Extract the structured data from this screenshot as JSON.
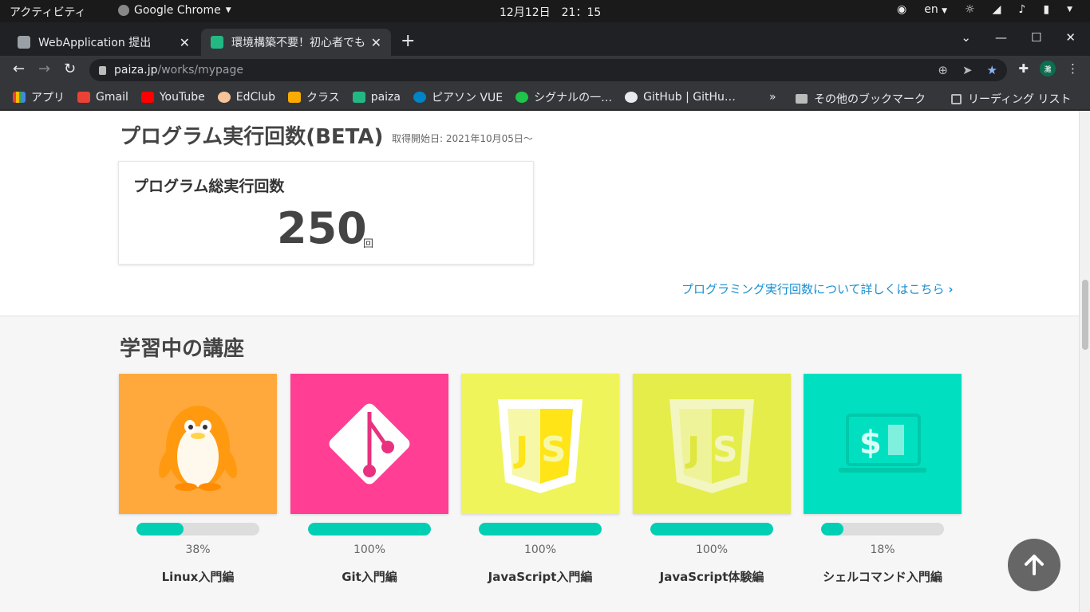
{
  "system_bar": {
    "activities": "アクティビティ",
    "app_name": "Google Chrome",
    "clock": "12月12日　21：15",
    "language": "en"
  },
  "tabs": [
    {
      "title": "WebApplication 提出",
      "active": false
    },
    {
      "title": "環境構築不要！初心者でも",
      "active": true
    }
  ],
  "address_bar": {
    "url_host": "paiza.jp",
    "url_path": "/works/mypage",
    "profile_initial": "灘"
  },
  "bookmarks": [
    {
      "label": "アプリ",
      "icon": "apps-grid-icon"
    },
    {
      "label": "Gmail",
      "icon": "gmail-icon"
    },
    {
      "label": "YouTube",
      "icon": "youtube-icon"
    },
    {
      "label": "EdClub",
      "icon": "edclub-icon"
    },
    {
      "label": "クラス",
      "icon": "classroom-icon"
    },
    {
      "label": "paiza",
      "icon": "paiza-icon"
    },
    {
      "label": "ピアソン VUE",
      "icon": "pearson-icon"
    },
    {
      "label": "シグナルの一…",
      "icon": "signal-icon"
    },
    {
      "label": "GitHub | GitHu…",
      "icon": "github-icon"
    }
  ],
  "bookmarks_overflow": "»",
  "other_bookmarks": "その他のブックマーク",
  "reading_list": "リーディング リスト",
  "exec": {
    "title": "プログラム実行回数(BETA)",
    "since": "取得開始日: 2021年10月05日〜",
    "card_label": "プログラム総実行回数",
    "count": "250",
    "unit": "回",
    "link": "プログラミング実行回数について詳しくはこちら"
  },
  "courses_title": "学習中の講座",
  "courses": [
    {
      "name": "Linux入門編",
      "percent_label": "38%",
      "progress": 0.38,
      "color": "#ffa93d",
      "icon": "linux-penguin-icon"
    },
    {
      "name": "Git入門編",
      "percent_label": "100%",
      "progress": 1.0,
      "color": "#ff3e94",
      "icon": "git-logo-icon"
    },
    {
      "name": "JavaScript入門編",
      "percent_label": "100%",
      "progress": 1.0,
      "color": "#eff45a",
      "icon": "javascript-shield-icon"
    },
    {
      "name": "JavaScript体験編",
      "percent_label": "100%",
      "progress": 1.0,
      "color": "#e5ed4a",
      "icon": "javascript-shield-icon"
    },
    {
      "name": "シェルコマンド入門編",
      "percent_label": "18%",
      "progress": 0.18,
      "color": "#00e0c1",
      "icon": "terminal-laptop-icon"
    }
  ],
  "colors": {
    "progress_fill": "#00cfb4",
    "link": "#1a8fd1"
  }
}
